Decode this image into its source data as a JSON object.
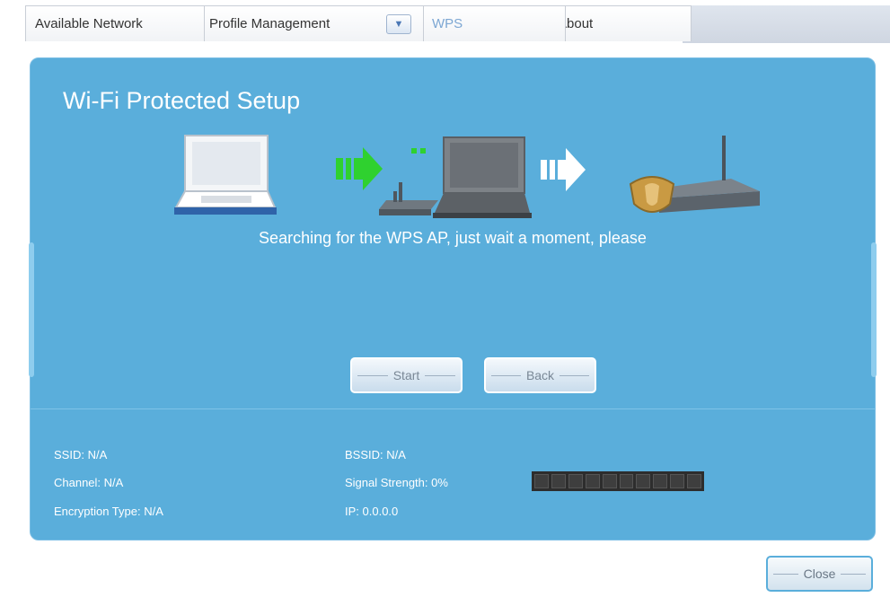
{
  "tabs": [
    {
      "label": "Available Network",
      "active": false
    },
    {
      "label": "Profile Management",
      "active": false
    },
    {
      "label": "WPS",
      "active": true
    },
    {
      "label": "About",
      "active": false
    }
  ],
  "title": "Wi-Fi Protected Setup",
  "status_message": "Searching for the WPS AP, just wait a moment, please",
  "buttons": {
    "start": "Start",
    "back": "Back",
    "close": "Close"
  },
  "info": {
    "ssid": "SSID: N/A",
    "channel": "Channel: N/A",
    "encryption": "Encryption Type: N/A",
    "bssid": "BSSID: N/A",
    "signal_strength": "Signal Strength: 0%",
    "ip": "IP: 0.0.0.0"
  },
  "signal": {
    "percent": 0,
    "segments": 10
  },
  "colors": {
    "panel": "#5aaedb",
    "active_tab_text": "#7da7d3",
    "green_arrow": "#2fd12f",
    "white_arrow": "#ffffff"
  },
  "icons": [
    "dropdown-arrow-icon",
    "laptop-icon",
    "green-arrow-icon",
    "router-icon",
    "white-arrow-icon",
    "shield-router-icon"
  ]
}
